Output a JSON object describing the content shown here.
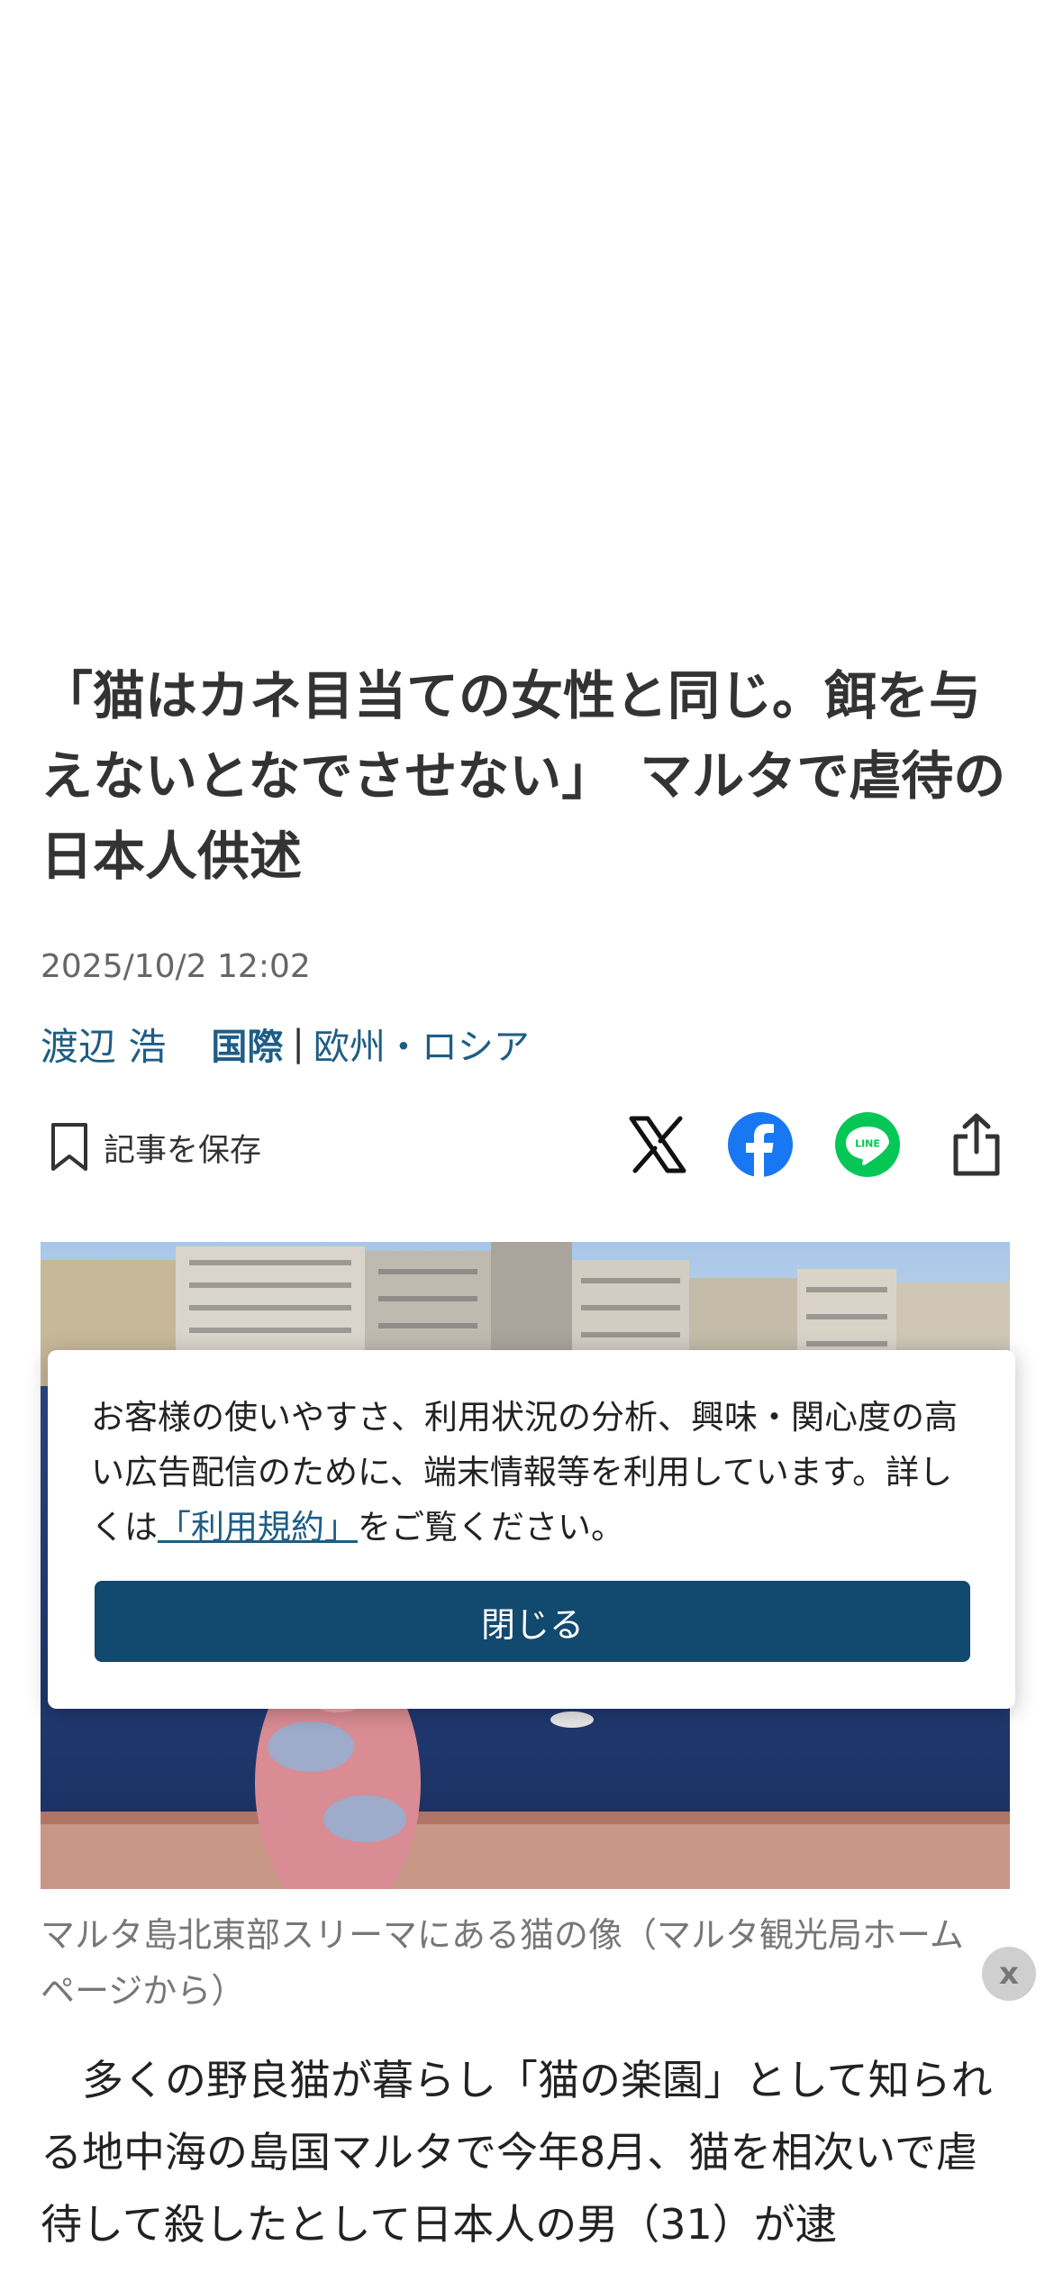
{
  "article": {
    "title": "「猫はカネ目当ての女性と同じ。餌を与えないとなでさせない」　マルタで虐待の日本人供述",
    "date": "2025/10/2 12:02",
    "author": "渡辺 浩",
    "category_main": "国際",
    "category_separator": "|",
    "category_sub": "欧州・ロシア",
    "save_label": "記事を保存",
    "photo_caption": "マルタ島北東部スリーマにある猫の像（マルタ観光局ホームページから）",
    "caption_close": "x",
    "body": "多くの野良猫が暮らし「猫の楽園」として知られる地中海の島国マルタで今年8月、猫を相次いで虐待して殺したとして日本人の男（31）が逮"
  },
  "share": {
    "icons": [
      "x-logo-icon",
      "facebook-icon",
      "line-icon",
      "share-icon"
    ],
    "line_label": "LINE"
  },
  "consent": {
    "text_before": "お客様の使いやすさ、利用状況の分析、興味・関心度の高い広告配信のために、端末情報等を利用しています。詳しくは",
    "link_text": "「利用規約」",
    "text_after": "をご覧ください。",
    "close_label": "閉じる"
  },
  "colors": {
    "link": "#1e5d86",
    "button": "#12496e",
    "facebook": "#1877f2",
    "line": "#06c755"
  }
}
